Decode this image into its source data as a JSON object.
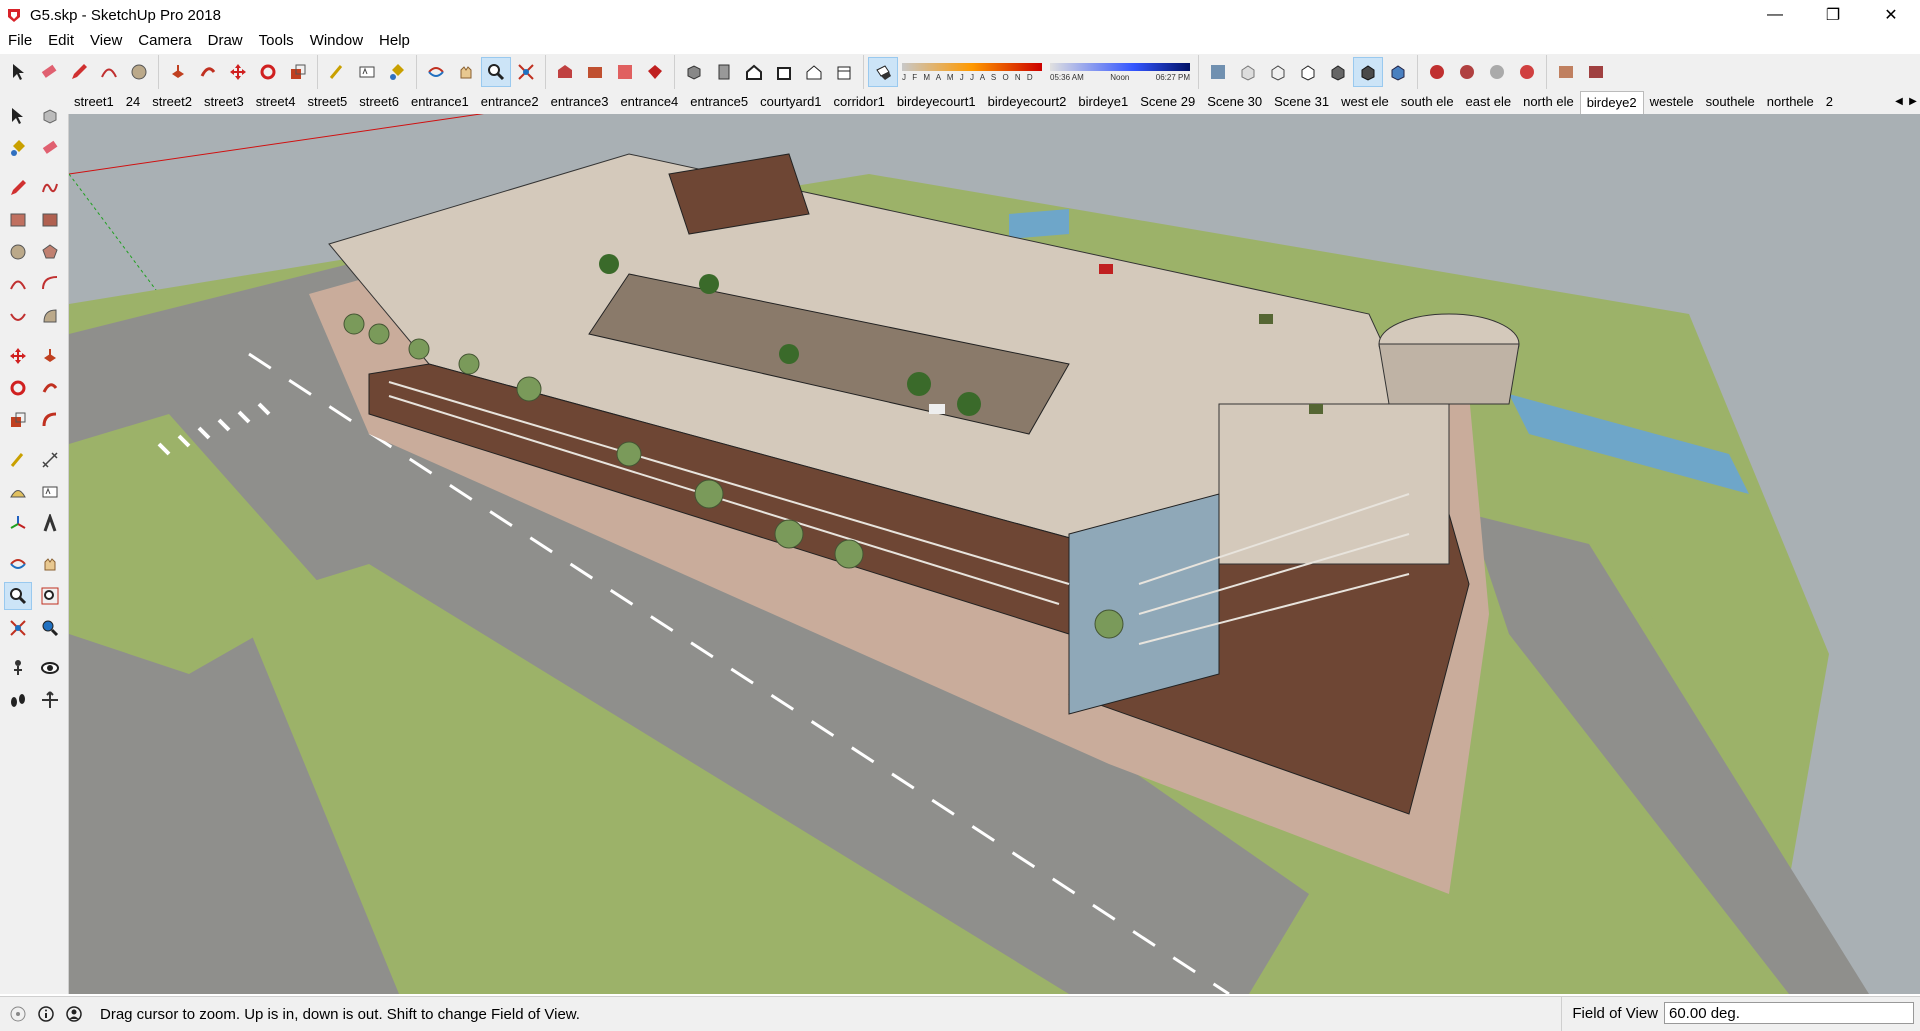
{
  "window": {
    "title": "G5.skp - SketchUp Pro 2018",
    "minimize": "—",
    "restore": "❐",
    "close": "✕"
  },
  "menu": [
    "File",
    "Edit",
    "View",
    "Camera",
    "Draw",
    "Tools",
    "Window",
    "Help"
  ],
  "shadow": {
    "months": "J F M A M J J A S O N D",
    "time_start": "05:36 AM",
    "time_mid": "Noon",
    "time_end": "06:27 PM"
  },
  "scenes": {
    "tabs": [
      "street1",
      "24",
      "street2",
      "street3",
      "street4",
      "street5",
      "street6",
      "entrance1",
      "entrance2",
      "entrance3",
      "entrance4",
      "entrance5",
      "courtyard1",
      "corridor1",
      "birdeyecourt1",
      "birdeyecourt2",
      "birdeye1",
      "Scene 29",
      "Scene 30",
      "Scene 31",
      "west ele",
      "south ele",
      "east ele",
      "north ele",
      "birdeye2",
      "westele",
      "southele",
      "northele",
      "2"
    ],
    "active": "birdeye2",
    "prev": "◀",
    "next": "▶"
  },
  "status": {
    "message": "Drag cursor to zoom.  Up is in, down is out. Shift to change Field of View.",
    "vcb_label": "Field of View",
    "vcb_value": "60.00 deg."
  },
  "colors": {
    "roof": "#d4c9bb",
    "brick": "#6e4634",
    "glass": "#8fa8b8",
    "grass": "#9cb269",
    "road": "#8f8f8c",
    "paving": "#c9ac9b",
    "water": "#6ea6c9",
    "sky": "#a9b0b4"
  }
}
